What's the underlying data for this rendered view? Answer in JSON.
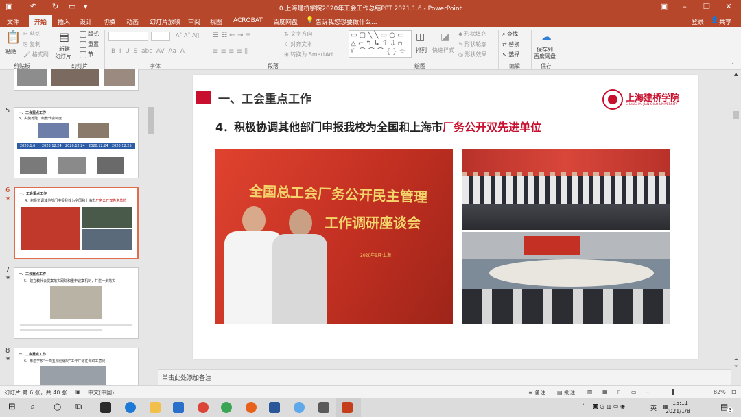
{
  "window": {
    "title": "0.上海建桥学院2020年工会工作总结PPT 2021.1.6 - PowerPoint",
    "login": "登录",
    "share": "共享"
  },
  "menu": {
    "file": "文件",
    "tabs": [
      "开始",
      "插入",
      "设计",
      "切换",
      "动画",
      "幻灯片放映",
      "审阅",
      "视图",
      "ACROBAT",
      "百度网盘"
    ],
    "active": "开始",
    "tell_me": "告诉我您想要做什么..."
  },
  "ribbon": {
    "clipboard": {
      "paste": "粘贴",
      "cut": "剪切",
      "copy": "复制",
      "format_painter": "格式刷",
      "label": "剪贴板"
    },
    "slides": {
      "new_slide": "新建",
      "new_slide2": "幻灯片",
      "layout": "版式",
      "reset": "重置",
      "section": "节",
      "label": "幻灯片"
    },
    "font": {
      "label": "字体"
    },
    "paragraph": {
      "text_direction": "文字方向",
      "align_text": "对齐文本",
      "smartart": "转换为 SmartArt",
      "label": "段落"
    },
    "drawing": {
      "arrange": "排列",
      "quick_styles": "快速样式",
      "shape_fill": "形状填充",
      "shape_outline": "形状轮廓",
      "shape_effects": "形状效果",
      "label": "绘图"
    },
    "editing": {
      "find": "查找",
      "replace": "替换",
      "select": "选择",
      "label": "编辑"
    },
    "save": {
      "save_to": "保存到",
      "baidu": "百度网盘",
      "label": "保存"
    }
  },
  "thumbnails": [
    {
      "num": "5",
      "heading": "一、工会重点工作",
      "sub": "3、实施筹建二级教代会制度",
      "dates": [
        "2020.1.6",
        "2020.12.24",
        "2020.12.24",
        "2020.12.24",
        "2020.12.25"
      ]
    },
    {
      "num": "6",
      "heading": "一、工会重点工作",
      "sub_a": "4、积极协调其他部门申报我校为全国和上海市",
      "sub_b": "厂务公开双先进单位",
      "selected": true
    },
    {
      "num": "7",
      "heading": "一、工会重点工作",
      "sub": "5、建立教代会提案落实跟踪和重申议案机制，并进一步落实"
    },
    {
      "num": "8",
      "heading": "一、工会重点工作",
      "sub": "6、推进学校“十四五规划编制”工作广泛征询职工意见"
    }
  ],
  "slide": {
    "heading": "一、工会重点工作",
    "subtitle_a": "4．积极协调其他部门申报我校为全国和上海市",
    "subtitle_b": "厂务公开双先进单位",
    "logo_cn": "上海建桥学院",
    "logo_en": "SHANGHAI JIAN QIAO UNIVERSITY",
    "banner_line1": "全国总工会厂务公开民主管理",
    "banner_line2": "工作调研座谈会",
    "banner_date": "2020年9月·上海"
  },
  "notes": {
    "placeholder": "单击此处添加备注"
  },
  "status": {
    "slide_info": "幻灯片 第 6 张，共 40 张",
    "language": "中文(中国)",
    "notes": "备注",
    "comments": "批注",
    "zoom": "82%"
  },
  "taskbar": {
    "ime": "英",
    "time": "15:11",
    "date": "2021/1/8",
    "notifications": "3"
  },
  "colors": {
    "accent": "#b7472a",
    "slide_red": "#c8102e"
  }
}
